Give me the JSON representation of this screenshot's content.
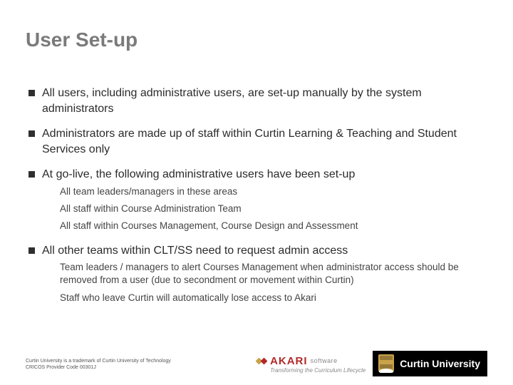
{
  "title": "User Set-up",
  "bullets": [
    {
      "text": "All users, including administrative users, are set-up manually by the system administrators"
    },
    {
      "text": "Administrators are made up of staff within Curtin Learning & Teaching and Student Services only"
    },
    {
      "text": "At go-live, the following administrative users have been set-up",
      "subs": [
        "All team leaders/managers in these areas",
        "All staff within Course Administration Team",
        "All staff within Courses Management, Course Design and Assessment"
      ]
    },
    {
      "text": "All other teams within CLT/SS need to request admin access",
      "subs": [
        "Team leaders / managers to alert Courses Management when administrator access should be removed from a user (due to secondment or movement within Curtin)",
        "Staff who leave Curtin will automatically lose access to Akari"
      ]
    }
  ],
  "footer": {
    "trademark": "Curtin University is a trademark of Curtin University of Technology",
    "cricos": "CRICOS Provider Code 00301J",
    "akari_name": "AKARI",
    "akari_soft": "software",
    "akari_tag": "Transforming the Curriculum Lifecycle",
    "curtin": "Curtin University"
  }
}
